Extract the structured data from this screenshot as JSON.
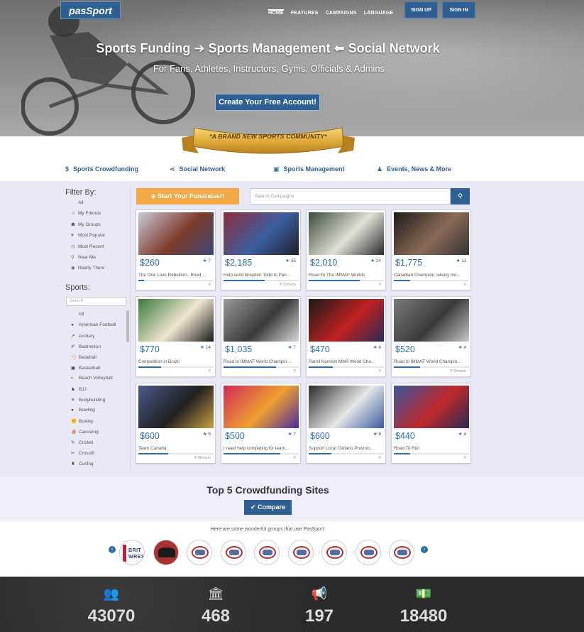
{
  "header": {
    "logo": "pasSport",
    "nav": [
      "HOME",
      "FEATURES",
      "CAMPAIGNS",
      "LANGUAGE"
    ],
    "signup": "SIGN UP",
    "signin": "SIGN IN"
  },
  "hero": {
    "title": "Sports Funding ➔ Sports Management ⬅ Social Network",
    "subtitle": "For Fans, Athletes, Instructors, Gyms, Officials & Admins",
    "cta": "Create Your Free Account!",
    "ribbon": "*A BRAND NEW SPORTS COMMUNITY*"
  },
  "features": [
    {
      "icon": "dollar-icon",
      "glyph": "$",
      "label": "Sports Crowdfunding"
    },
    {
      "icon": "share-icon",
      "glyph": "⋖",
      "label": "Social Network"
    },
    {
      "icon": "briefcase-icon",
      "glyph": "▣",
      "label": "Sports Management"
    },
    {
      "icon": "bell-icon",
      "glyph": "♟",
      "label": "Events, News & More"
    }
  ],
  "sidebar": {
    "filter_title": "Filter By:",
    "filters": [
      {
        "label": "All",
        "glyph": ""
      },
      {
        "label": "My Friends",
        "glyph": "☺"
      },
      {
        "label": "My Groups",
        "glyph": "☗"
      },
      {
        "label": "Most Popular",
        "glyph": "♥"
      },
      {
        "label": "Most Recent",
        "glyph": "◷"
      },
      {
        "label": "Near Me",
        "glyph": "⚲"
      },
      {
        "label": "Nearly There",
        "glyph": "◉"
      }
    ],
    "sports_title": "Sports:",
    "search_placeholder": "Search",
    "sports": [
      {
        "label": "All",
        "glyph": ""
      },
      {
        "label": "American Football",
        "glyph": "●"
      },
      {
        "label": "Archery",
        "glyph": "↗"
      },
      {
        "label": "Badminton",
        "glyph": "✐"
      },
      {
        "label": "Baseball",
        "glyph": "⚾"
      },
      {
        "label": "Basketball",
        "glyph": "▣"
      },
      {
        "label": "Beach Volleyball",
        "glyph": "◐"
      },
      {
        "label": "BJJ",
        "glyph": "♞"
      },
      {
        "label": "Bodybuilding",
        "glyph": "✕"
      },
      {
        "label": "Bowling",
        "glyph": "●"
      },
      {
        "label": "Boxing",
        "glyph": "✊"
      },
      {
        "label": "Canoeing",
        "glyph": "⛵"
      },
      {
        "label": "Cricket",
        "glyph": "✎"
      },
      {
        "label": "Crossfit",
        "glyph": "✂"
      },
      {
        "label": "Curling",
        "glyph": "♜"
      }
    ]
  },
  "toolbar": {
    "start_label": "Start Your Fundraiser!",
    "search_placeholder": "Search Campaigns"
  },
  "campaigns": [
    {
      "amount": "$260",
      "stars": "7",
      "desc": "The One Love Rebellion - Road ...",
      "loc": "",
      "progress": 0.08
    },
    {
      "amount": "$2,185",
      "stars": "35",
      "desc": "Help send Brayden Todd to Pan...",
      "loc": "Ontario",
      "progress": 0.55
    },
    {
      "amount": "$2,010",
      "stars": "24",
      "desc": "Road To The IMMAF Worlds",
      "loc": "",
      "progress": 0.68
    },
    {
      "amount": "$1,775",
      "stars": "11",
      "desc": "Canadian Champion raising mo...",
      "loc": "",
      "progress": 0.22
    },
    {
      "amount": "$770",
      "stars": "14",
      "desc": "Competition in Brazil",
      "loc": "",
      "progress": 0.3
    },
    {
      "amount": "$1,035",
      "stars": "7",
      "desc": "Road to IMMAF World Champio...",
      "loc": "",
      "progress": 0.7
    },
    {
      "amount": "$470",
      "stars": "4",
      "desc": "Ramil Kamilov MMA World Cha...",
      "loc": "",
      "progress": 0.32
    },
    {
      "amount": "$520",
      "stars": "4",
      "desc": "Road to IMMAF World Champio...",
      "loc": "Ontario",
      "progress": 0.35
    },
    {
      "amount": "$600",
      "stars": "5",
      "desc": "Team Canada",
      "loc": "Ontario",
      "progress": 0.4
    },
    {
      "amount": "$500",
      "stars": "7",
      "desc": "I need help competing for team...",
      "loc": "",
      "progress": 0.75
    },
    {
      "amount": "$600",
      "stars": "8",
      "desc": "Support Local 'Ontario Provinci...",
      "loc": "",
      "progress": 0.3
    },
    {
      "amount": "$440",
      "stars": "4",
      "desc": "Road To Rio!",
      "loc": "",
      "progress": 0.22
    }
  ],
  "top5": {
    "title": "Top 5 Crowdfunding Sites",
    "compare": "✔ Compare"
  },
  "groups": {
    "caption": "Here are some wonderful groups that use PasSport:",
    "first_logo_text": "BRIT WRES"
  },
  "stats": [
    {
      "icon": "users-icon",
      "glyph": "👥",
      "value": "43070"
    },
    {
      "icon": "bank-icon",
      "glyph": "🏛",
      "value": "468"
    },
    {
      "icon": "megaphone-icon",
      "glyph": "📢",
      "value": "197"
    },
    {
      "icon": "money-icon",
      "glyph": "💵",
      "value": "18480"
    }
  ],
  "colors": {
    "brand": "#2f5f93",
    "accent_orange": "#f1a845",
    "amount_blue": "#2f6fa8"
  }
}
